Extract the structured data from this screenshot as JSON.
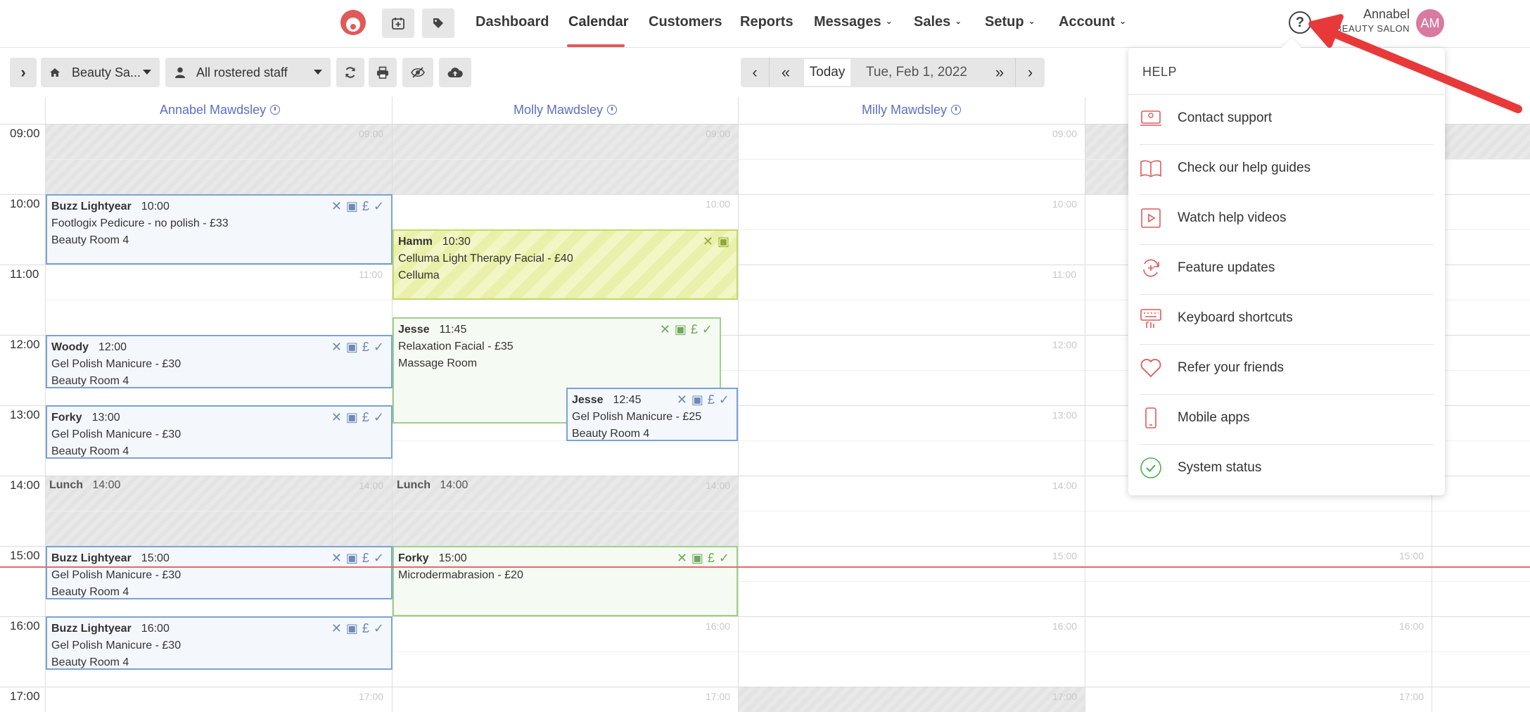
{
  "nav": {
    "links": [
      "Dashboard",
      "Calendar",
      "Customers",
      "Reports",
      "Messages",
      "Sales",
      "Setup",
      "Account"
    ],
    "active": "Calendar",
    "user_name": "Annabel",
    "user_sub": "BEAUTY SALON",
    "avatar_initials": "AM"
  },
  "toolbar": {
    "location": "Beauty Sa...",
    "staff_filter": "All rostered staff",
    "today_label": "Today",
    "date": "Tue, Feb 1, 2022"
  },
  "staff": [
    "Annabel Mawdsley",
    "Molly Mawdsley",
    "Milly Mawdsley"
  ],
  "hours": [
    "09:00",
    "10:00",
    "11:00",
    "12:00",
    "13:00",
    "14:00",
    "15:00",
    "16:00",
    "17:00"
  ],
  "appointments": {
    "a1": {
      "client": "Buzz Lightyear",
      "time": "10:00",
      "service": "Footlogix Pedicure - no polish - £33",
      "room": "Beauty Room 4"
    },
    "a2": {
      "client": "Woody",
      "time": "12:00",
      "service": "Gel Polish Manicure - £30",
      "room": "Beauty Room 4"
    },
    "a3": {
      "client": "Forky",
      "time": "13:00",
      "service": "Gel Polish Manicure - £30",
      "room": "Beauty Room 4"
    },
    "a4": {
      "client": "Buzz Lightyear",
      "time": "15:00",
      "service": "Gel Polish Manicure - £30",
      "room": "Beauty Room 4"
    },
    "a5": {
      "client": "Buzz Lightyear",
      "time": "16:00",
      "service": "Gel Polish Manicure - £30",
      "room": "Beauty Room 4"
    },
    "b1": {
      "client": "Hamm",
      "time": "10:30",
      "service": "Celluma Light Therapy Facial - £40",
      "room": "Celluma"
    },
    "b2": {
      "client": "Jesse",
      "time": "11:45",
      "service": "Relaxation Facial - £35",
      "room": "Massage Room"
    },
    "b3": {
      "client": "Jesse",
      "time": "12:45",
      "service": "Gel Polish Manicure - £25",
      "room": "Beauty Room 4"
    },
    "b4": {
      "client": "Forky",
      "time": "15:00",
      "service": "Microdermabrasion - £20",
      "room": ""
    }
  },
  "lunch": {
    "label": "Lunch",
    "time": "14:00"
  },
  "help": {
    "title": "HELP",
    "items": [
      "Contact support",
      "Check our help guides",
      "Watch help videos",
      "Feature updates",
      "Keyboard shortcuts",
      "Refer your friends",
      "Mobile apps",
      "System status"
    ]
  },
  "colors": {
    "accent": "#e05a5a",
    "staff_link": "#5b6fc7",
    "avatar": "#d97aa0"
  }
}
